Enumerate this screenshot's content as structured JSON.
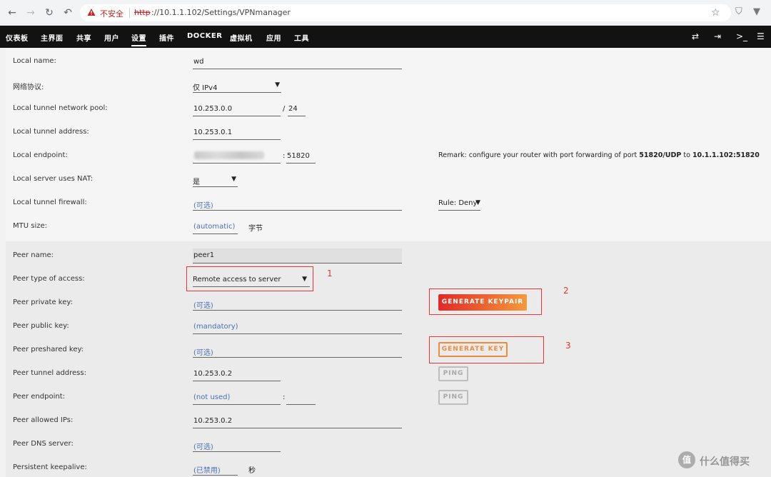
{
  "browser": {
    "insecure_label": "不安全",
    "url_protocol": "http",
    "url_rest": "://10.1.1.102/Settings/VPNmanager"
  },
  "menu": {
    "items": [
      "仪表板",
      "主界面",
      "共享",
      "用户",
      "设置",
      "插件",
      "DOCKER",
      "虚拟机",
      "应用",
      "工具"
    ],
    "active": "设置"
  },
  "form": {
    "local_name": {
      "label": "Local name:",
      "value": "wd"
    },
    "protocol": {
      "label": "网络协议:",
      "value": "仅 IPv4"
    },
    "network_pool": {
      "label": "Local tunnel network pool:",
      "value": "10.253.0.0",
      "prefix": "/ 24"
    },
    "tunnel_address": {
      "label": "Local tunnel address:",
      "value": "10.253.0.1"
    },
    "endpoint": {
      "label": "Local endpoint:",
      "port": ": 51820"
    },
    "nat": {
      "label": "Local server uses NAT:",
      "value": "是"
    },
    "firewall": {
      "label": "Local tunnel firewall:",
      "value": "(可选)",
      "rule": "Rule: Deny"
    },
    "mtu": {
      "label": "MTU size:",
      "value": "(automatic)",
      "unit": "字节"
    },
    "remark": {
      "prefix": "Remark: configure your router with port forwarding of port ",
      "port": "51820/UDP",
      "to": " to ",
      "target": "10.1.1.102:51820"
    }
  },
  "peer": {
    "name": {
      "label": "Peer name:",
      "value": "peer1"
    },
    "access": {
      "label": "Peer type of access:",
      "value": "Remote access to server"
    },
    "private_key": {
      "label": "Peer private key:",
      "value": "(可选)"
    },
    "public_key": {
      "label": "Peer public key:",
      "value": "(mandatory)"
    },
    "preshared_key": {
      "label": "Peer preshared key:",
      "value": "(可选)"
    },
    "tunnel_address": {
      "label": "Peer tunnel address:",
      "value": "10.253.0.2"
    },
    "endpoint": {
      "label": "Peer endpoint:",
      "value": "(not used)",
      "colon": ":"
    },
    "allowed_ips": {
      "label": "Peer allowed IPs:",
      "value": "10.253.0.2"
    },
    "dns": {
      "label": "Peer DNS server:",
      "value": "(可选)"
    },
    "keepalive": {
      "label": "Persistent keepalive:",
      "value": "(已禁用)",
      "unit": "秒"
    }
  },
  "buttons": {
    "generate_keypair": "GENERATE KEYPAIR",
    "generate_key": "GENERATE KEY",
    "ping": "PING"
  },
  "annotations": {
    "one": "1",
    "two": "2",
    "three": "3"
  },
  "watermark": {
    "glyph": "值",
    "text": "什么值得买"
  },
  "colors": {
    "annotation_red": "#ee3333",
    "accent_orange": "#f08b3a",
    "menu_bg": "#121212"
  }
}
